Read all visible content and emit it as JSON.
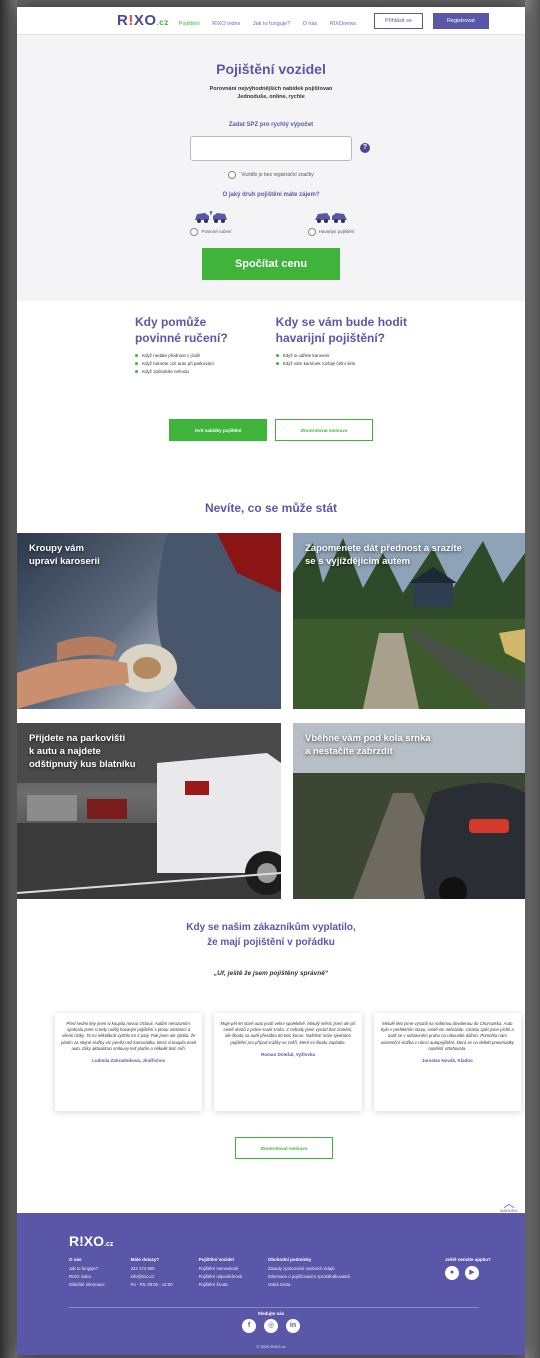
{
  "colors": {
    "brand": "#5b57a8",
    "accent_green": "#3fb33a",
    "logo_accent": "#e64a3d",
    "hero_bg": "#f4f4f6"
  },
  "header": {
    "logo": {
      "main": "R",
      "excl": "!",
      "rest": "XO",
      "cz": ".cz"
    },
    "nav": [
      "Pojištění",
      "RIXO index",
      "Jak to funguje?",
      "O nás",
      "RIXOnews"
    ],
    "login": "Přihlásit se",
    "register": "Registrovat"
  },
  "hero": {
    "title": "Pojištění vozidel",
    "subtitle_1": "Porovnání nejvýhodnějších nabídek pojištovan",
    "subtitle_2": "Jednoduše, online, rychle",
    "spz_label": "Zadat SPZ pro rychlý výpočet",
    "spz_placeholder": "",
    "help": "?",
    "no_spz": "Vozidlo je bez registrační značky",
    "question": "O jaký druh pojištění máte zájem?",
    "types": [
      "Povinné ručení",
      "Havarijní pojištění"
    ],
    "cta": "Spočítat cenu"
  },
  "info": {
    "left_title_1": "Kdy pomůže",
    "left_title_2": "povinné ručení?",
    "left_items": [
      "Když nedáte přednost v jízdě",
      "Když ťuknete cizí auto při parkování",
      "Když způsobíte nehodu"
    ],
    "right_title_1": "Kdy se vám bude hodit",
    "right_title_2": "havarijní pojištění?",
    "right_items": [
      "Když si odřete karoserii",
      "Když vám kamínek rozbije čelní sklo"
    ],
    "btn_offers": "Ovit nabídky pojištění",
    "btn_compare": "Zkontrolovat smlouvu"
  },
  "scenarios": {
    "title": "Nevíte, co se může stát",
    "tiles": [
      {
        "line1": "Kroupy vám",
        "line2": "upraví karoserii"
      },
      {
        "line1": "Zapomenete dát přednost a srazíte",
        "line2": "se s vyjíždějícím autem"
      },
      {
        "line1": "Přijdete na parkovišti",
        "line2": "k autu a najdete",
        "line3": "odštípnutý kus blatníku"
      },
      {
        "line1": "Vběhne vám pod kola srnka",
        "line2": "a nestačíte zabrzdit"
      }
    ]
  },
  "testimonials": {
    "title_1": "Kdy se našim zákazníkům vyplatilo,",
    "title_2": "že mají pojištění v pořádku",
    "quote": "„Uf, ještě že jsem pojištěný správně“",
    "cards": [
      {
        "text": "Před sedmi lety jsem si koupila novou Octavii. Autům nerozumím, sjednala jsem si tedy raději havarijní pojištění s plnou asistencí a všemi riziky. To mi několikrát vytrhlo trn z paty. Pak jsem ale zjistila, že platím za stejné služby víc peněz než kamarádka, která si koupila nové auto. Díky aktualizaci smlouvy teď platím o několik tisíc míň.",
        "author": "Ludmila Zahradníková, Jindřichov"
      },
      {
        "text": "Moje pět let staré auto jezdí velmi spolehlivě. Minulý měsíc jsem ale při cestě domů z práce srazil srnku. Z nehody jsem vyvázl bez zranění, ale škoda na autě přesáhla 60 tisíc korun. Naštěstí mám sjednáno pojištění pro případ srážky se zvěří, které mi škodu zaplatilo.",
        "author": "Roman Doležal, Vyžlovka"
      },
      {
        "text": "Minulé léto jsme vyrazili na rodinnou dovolenou do Chorvatska. Auto bylo v perfektním stavu, cestě nic nebránilo. Cestou zpět jsme píchli a ocitli se v odstavném pruhu na rakouské dálnici. Pomohla nám asistenční služba v rámci autopojištění, která se na defekt pneumatiky nastěstí vztahovala.",
        "author": "Jaroslav Novák, Kladno"
      }
    ],
    "btn_compare": "Zkontrolovat smlouvu"
  },
  "to_top": "NAHORU",
  "footer": {
    "logo_main": "R!XO",
    "logo_cz": ".cz",
    "columns": [
      {
        "title": "O nás",
        "items": [
          "Jak to funguje?",
          "RIXO index",
          "Důležité informace"
        ]
      },
      {
        "title": "Máte dotazy?",
        "items": [
          "224 174 900",
          "info@rixo.cz",
          "Po - Pá: 09:00 - 14:00"
        ]
      },
      {
        "title": "Pojištění vozidel",
        "items": [
          "Pojištění nemovitostí",
          "Pojištění odpovědnosti",
          "Pojištění života"
        ]
      },
      {
        "title": "Obchodní podmínky",
        "items": [
          "Zásady zpracování osobních údajů",
          "Informace o pojišťovacím zprostředkovateli",
          "Volná místa"
        ]
      }
    ],
    "app_title": "Ještě nemáte appku?",
    "follow": "Sledujte nás",
    "social": [
      "f",
      "◎",
      "in"
    ],
    "copyright": "© 2020 RIXO.cz"
  }
}
